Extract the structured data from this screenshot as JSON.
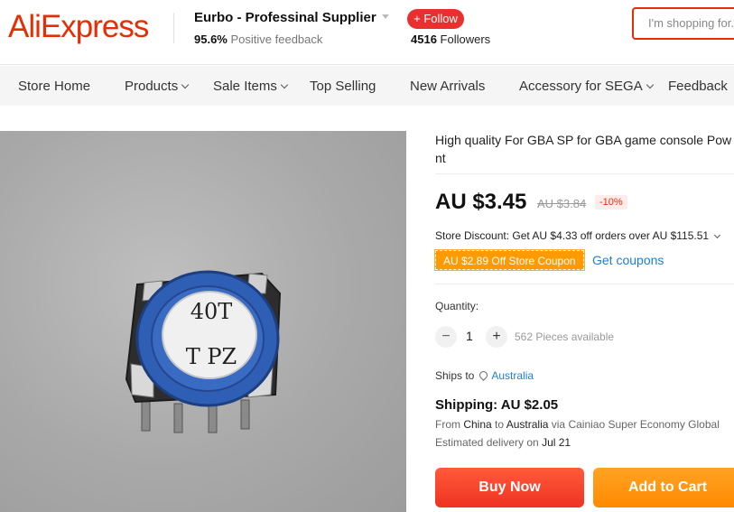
{
  "header": {
    "logo": "AliExpress",
    "store_name": "Eurbo - Professinal Supplier",
    "feedback_value": "95.6%",
    "feedback_label": "Positive feedback",
    "follow_label": "+ Follow",
    "followers_count": "4516",
    "followers_label": "Followers",
    "search_placeholder": "I'm shopping for..."
  },
  "nav": {
    "items": [
      {
        "label": "Store Home"
      },
      {
        "label": "Products"
      },
      {
        "label": "Sale Items"
      },
      {
        "label": "Top Selling"
      },
      {
        "label": "New Arrivals"
      },
      {
        "label": "Accessory for SEGA"
      },
      {
        "label": "Feedback"
      }
    ]
  },
  "product": {
    "image_text_line1": "40T",
    "image_text_line2": "T PZ",
    "title_line1": "High quality For GBA SP for GBA game console Pow",
    "title_line2": "nt",
    "price": "AU $3.45",
    "old_price": "AU $3.84",
    "discount": "-10%",
    "store_discount": "Store Discount: Get AU $4.33 off orders over AU $115.51",
    "coupon": "AU $2.89 Off Store Coupon",
    "get_coupons": "Get coupons",
    "quantity_label": "Quantity:",
    "quantity_value": "1",
    "minus": "−",
    "plus": "+",
    "available": "562 Pieces available",
    "ships_to_label": "Ships to",
    "ships_to_dest": "Australia",
    "shipping": "Shipping: AU $2.05",
    "from_text": "From",
    "from_origin": "China",
    "from_to": "to",
    "from_dest": "Australia",
    "from_via": "via Cainiao Super Economy Global",
    "delivery_label": "Estimated delivery on",
    "delivery_date": "Jul 21",
    "buy_now": "Buy Now",
    "add_to_cart": "Add to Cart"
  },
  "colors": {
    "brand": "#e62e04",
    "link": "#1f7fcf",
    "buy_now": "#ee3322",
    "add_to_cart": "#ff8a00",
    "coupon": "#ff9a00"
  }
}
